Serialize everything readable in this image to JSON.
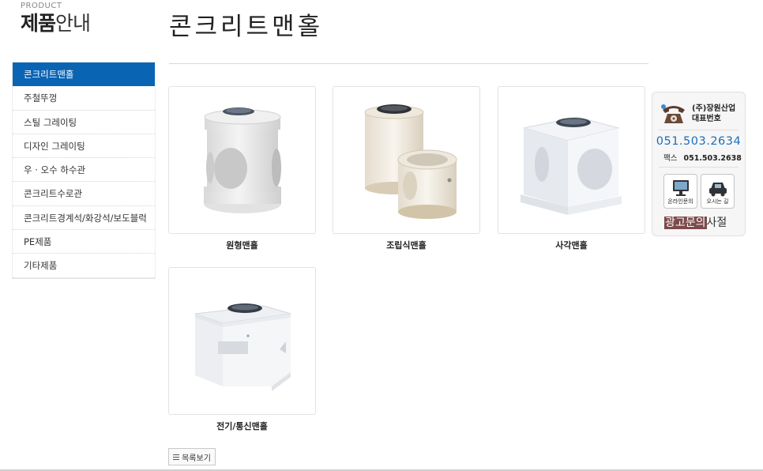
{
  "section": {
    "small": "PRODUCT",
    "title_bold": "제품",
    "title_rest": "안내"
  },
  "page_title": "콘크리트맨홀",
  "sidebar": {
    "items": [
      {
        "label": "콘크리트맨홀",
        "active": true
      },
      {
        "label": "주철뚜껑"
      },
      {
        "label": "스틸 그레이팅"
      },
      {
        "label": "디자인 그레이팅"
      },
      {
        "label": "우 · 오수 하수관"
      },
      {
        "label": "콘크리트수로관"
      },
      {
        "label": "콘크리트경계석/화강석/보도블럭"
      },
      {
        "label": "PE제품"
      },
      {
        "label": "기타제품"
      }
    ]
  },
  "products": [
    {
      "name": "원형맨홀",
      "image": "round-manhole"
    },
    {
      "name": "조립식맨홀",
      "image": "prefab-manhole"
    },
    {
      "name": "사각맨홀",
      "image": "square-manhole"
    },
    {
      "name": "전기/통신맨홀",
      "image": "electric-manhole"
    }
  ],
  "list_button": {
    "label": "목록보기",
    "icon": "list-icon"
  },
  "contact": {
    "icon": "telephone-icon",
    "company": "(주)장원산업",
    "rep_label": "대표번호",
    "phone": "051.503.2634",
    "fax_label": "팩스",
    "fax": "051.503.2638",
    "buttons": [
      {
        "label": "온라인문의",
        "icon": "monitor-icon"
      },
      {
        "label": "오시는 길",
        "icon": "car-icon"
      }
    ],
    "ad_highlight": "광고문의",
    "ad_rest": "사절"
  },
  "colors": {
    "accent": "#0a64b4",
    "phone": "#1a6fba",
    "ad_highlight": "#7d4a4a"
  }
}
